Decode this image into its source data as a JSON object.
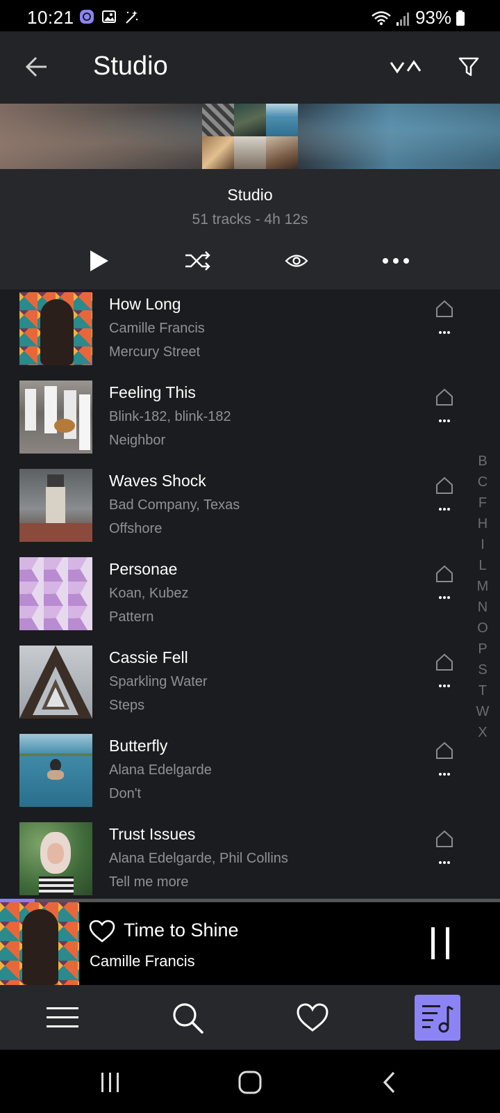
{
  "status_bar": {
    "time": "10:21",
    "battery": "93%",
    "icons": [
      "messenger-icon",
      "gallery-icon",
      "magic-wand-icon",
      "wifi-icon",
      "signal-icon",
      "battery-icon"
    ]
  },
  "app_bar": {
    "title": "Studio",
    "icons": {
      "back": "arrow-left-icon",
      "sort": "sort-arrows-icon",
      "filter": "filter-icon"
    }
  },
  "playlist": {
    "title": "Studio",
    "meta": "51 tracks - 4h 12s",
    "actions": [
      "play-icon",
      "shuffle-icon",
      "eye-icon",
      "more-icon"
    ]
  },
  "tracks": [
    {
      "title": "How Long",
      "artist": "Camille Francis",
      "album": "Mercury Street"
    },
    {
      "title": "Feeling This",
      "artist": "Blink-182, blink-182",
      "album": "Neighbor"
    },
    {
      "title": "Waves Shock",
      "artist": "Bad Company, Texas",
      "album": "Offshore"
    },
    {
      "title": "Personae",
      "artist": "Koan, Kubez",
      "album": "Pattern"
    },
    {
      "title": "Cassie Fell",
      "artist": "Sparkling Water",
      "album": "Steps"
    },
    {
      "title": "Butterfly",
      "artist": "Alana Edelgarde",
      "album": "Don't"
    },
    {
      "title": "Trust Issues",
      "artist": "Alana Edelgarde, Phil Collins",
      "album": "Tell me more"
    }
  ],
  "alphabet_index": [
    "B",
    "C",
    "F",
    "H",
    "I",
    "L",
    "M",
    "N",
    "O",
    "P",
    "S",
    "T",
    "W",
    "X"
  ],
  "mini_player": {
    "title": "Time to Shine",
    "artist": "Camille Francis",
    "progress": 0.07
  },
  "bottom_nav": {
    "items": [
      "menu-icon",
      "search-icon",
      "heart-icon",
      "queue-music-icon"
    ],
    "active": "queue-music-icon"
  },
  "colors": {
    "accent": "#8c84f5",
    "background": "#1b1c1f",
    "header": "#27282b",
    "secondary_text": "#909195"
  }
}
